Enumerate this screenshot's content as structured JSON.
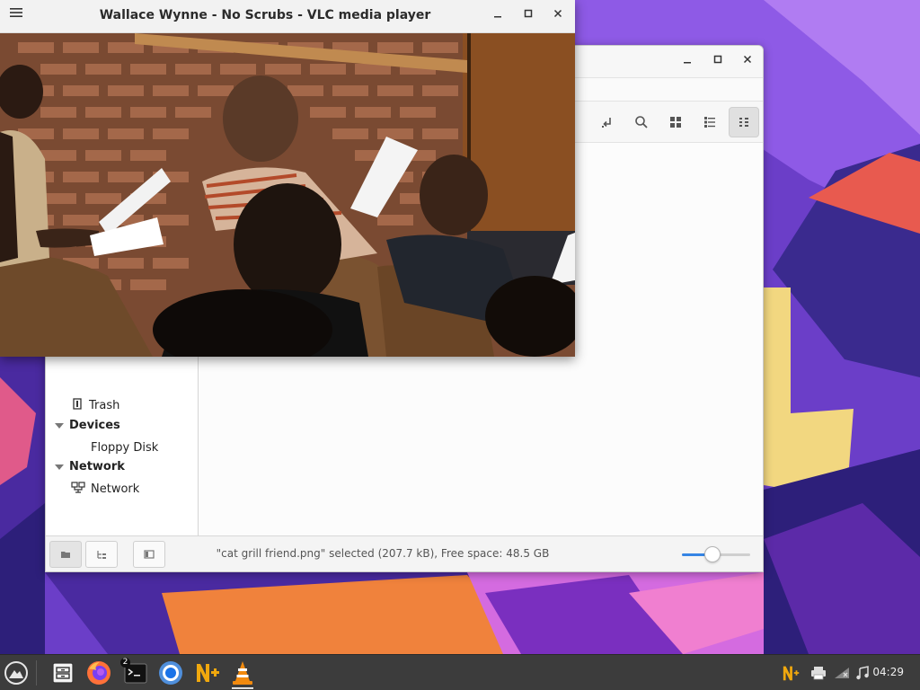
{
  "vlc": {
    "title": "Wallace Wynne - No Scrubs - VLC media player",
    "menu_icon": "hamburger-menu-icon",
    "minimize_icon": "minimize-icon",
    "maximize_icon": "maximize-icon",
    "close_icon": "close-icon"
  },
  "file_manager": {
    "minimize_icon": "minimize-icon",
    "maximize_icon": "maximize-icon",
    "close_icon": "close-icon",
    "toolbar": {
      "icons": [
        "go-to-location-icon",
        "search-icon",
        "icon-view-icon",
        "list-view-icon",
        "compact-view-icon"
      ],
      "active": "compact-view-icon"
    },
    "sidebar": {
      "partial_item": {
        "label": "Trash",
        "icon": "trash-icon"
      },
      "sections": [
        {
          "label": "Devices",
          "items": [
            {
              "label": "Floppy Disk",
              "icon": "floppy-disk-icon"
            }
          ]
        },
        {
          "label": "Network",
          "items": [
            {
              "label": "Network",
              "icon": "network-icon"
            }
          ]
        }
      ]
    },
    "status": {
      "text": "\"cat grill friend.png\" selected (207.7 kB), Free space: 48.5 GB",
      "zoom_level": 0.45
    }
  },
  "taskbar": {
    "apps": [
      {
        "name": "menu",
        "icon": "app-menu-icon"
      },
      {
        "name": "file-manager",
        "icon": "file-manager-icon"
      },
      {
        "name": "firefox",
        "icon": "firefox-icon"
      },
      {
        "name": "terminal",
        "icon": "terminal-icon",
        "badge": "2"
      },
      {
        "name": "chromium",
        "icon": "chromium-icon"
      },
      {
        "name": "nplus",
        "icon": "nplus-icon"
      },
      {
        "name": "vlc",
        "icon": "vlc-icon"
      }
    ],
    "tray": [
      "nplus-tray-icon",
      "printer-icon",
      "network-disconnected-icon",
      "music-icon"
    ],
    "clock": "04:29"
  },
  "colors": {
    "accent": "#3584e4",
    "taskbar": "#3c3c3c",
    "vlc_orange": "#f28a0e"
  }
}
